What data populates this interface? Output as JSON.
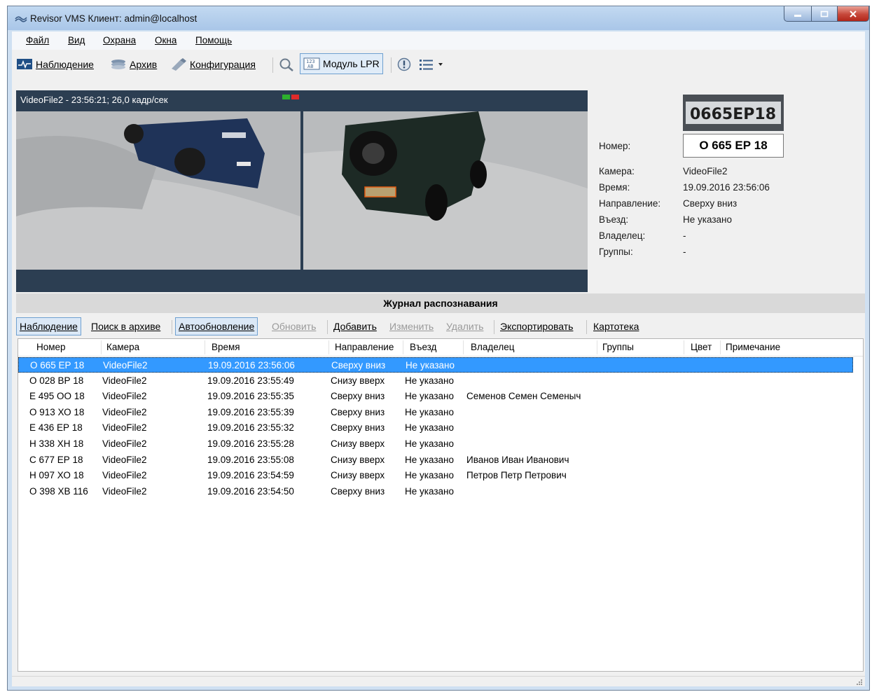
{
  "window": {
    "title": "Revisor VMS Клиент: admin@localhost"
  },
  "menu": [
    {
      "label": "Файл"
    },
    {
      "label": "Вид"
    },
    {
      "label": "Охрана"
    },
    {
      "label": "Окна"
    },
    {
      "label": "Помощь"
    }
  ],
  "toolbar": {
    "observe": "Наблюдение",
    "archive": "Архив",
    "config": "Конфигурация",
    "lpr": "Модуль LPR"
  },
  "video": {
    "caption": "VideoFile2 - 23:56:21; 26,0 кадр/сек"
  },
  "info": {
    "plate_image_text": "0665EP18",
    "number_label": "Номер:",
    "number_value": "О 665 ЕР 18",
    "camera_label": "Камера:",
    "camera_value": "VideoFile2",
    "time_label": "Время:",
    "time_value": "19.09.2016 23:56:06",
    "direction_label": "Направление:",
    "direction_value": "Сверху вниз",
    "entry_label": "Въезд:",
    "entry_value": "Не указано",
    "owner_label": "Владелец:",
    "owner_value": "-",
    "groups_label": "Группы:",
    "groups_value": "-"
  },
  "journal": {
    "title": "Журнал распознавания",
    "buttons": {
      "observe": "Наблюдение",
      "search": "Поиск в архиве",
      "autoupdate": "Автообновление",
      "refresh": "Обновить",
      "add": "Добавить",
      "edit": "Изменить",
      "delete": "Удалить",
      "export": "Экспортировать",
      "catalog": "Картотека"
    },
    "columns": [
      "Номер",
      "Камера",
      "Время",
      "Направление",
      "Въезд",
      "Владелец",
      "Группы",
      "Цвет",
      "Примечание"
    ],
    "rows": [
      [
        "О 665 ЕР 18",
        "VideoFile2",
        "19.09.2016 23:56:06",
        "Сверху вниз",
        "Не указано",
        "",
        "",
        "",
        ""
      ],
      [
        "О 028 ВР 18",
        "VideoFile2",
        "19.09.2016 23:55:49",
        "Снизу вверх",
        "Не указано",
        "",
        "",
        "",
        ""
      ],
      [
        "Е 495 ОО 18",
        "VideoFile2",
        "19.09.2016 23:55:35",
        "Сверху вниз",
        "Не указано",
        "Семенов Семен Семеныч",
        "",
        "",
        ""
      ],
      [
        "О 913 ХО 18",
        "VideoFile2",
        "19.09.2016 23:55:39",
        "Сверху вниз",
        "Не указано",
        "",
        "",
        "",
        ""
      ],
      [
        "Е 436 ЕР 18",
        "VideoFile2",
        "19.09.2016 23:55:32",
        "Сверху вниз",
        "Не указано",
        "",
        "",
        "",
        ""
      ],
      [
        "Н 338 ХН 18",
        "VideoFile2",
        "19.09.2016 23:55:28",
        "Снизу вверх",
        "Не указано",
        "",
        "",
        "",
        ""
      ],
      [
        "С 677 ЕР 18",
        "VideoFile2",
        "19.09.2016 23:55:08",
        "Снизу вверх",
        "Не указано",
        "Иванов Иван Иванович",
        "",
        "",
        ""
      ],
      [
        "Н 097 ХО 18",
        "VideoFile2",
        "19.09.2016 23:54:59",
        "Снизу вверх",
        "Не указано",
        "Петров Петр Петрович",
        "",
        "",
        ""
      ],
      [
        "О 398 ХВ 116",
        "VideoFile2",
        "19.09.2016 23:54:50",
        "Сверху вниз",
        "Не указано",
        "",
        "",
        "",
        ""
      ]
    ],
    "selected_row": 0
  },
  "colors": {
    "selection": "#3399ff",
    "video_bg": "#2c3e52",
    "toggle_on": "#dbe8f6"
  }
}
